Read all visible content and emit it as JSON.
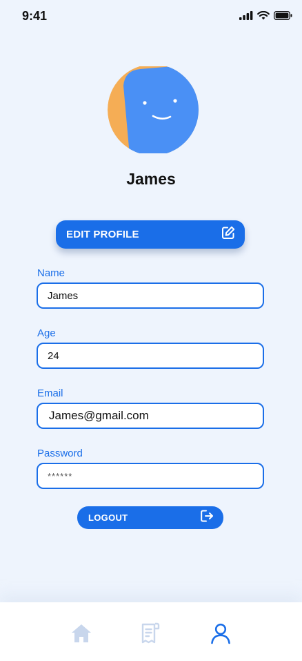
{
  "status_bar": {
    "time": "9:41",
    "icons": [
      "signal-icon",
      "wifi-icon",
      "battery-icon"
    ]
  },
  "profile": {
    "name": "James",
    "avatar_icon": "smiley-avatar-icon"
  },
  "edit_button": {
    "label": "EDIT PROFILE",
    "icon": "edit-icon"
  },
  "form": {
    "name_label": "Name",
    "name_value": "James",
    "age_label": "Age",
    "age_value": "24",
    "email_label": "Email",
    "email_value": "James@gmail.com",
    "password_label": "Password",
    "password_value": "******"
  },
  "logout_button": {
    "label": "LOGOUT",
    "icon": "logout-icon"
  },
  "tabbar": {
    "tabs": [
      {
        "name": "home",
        "icon": "home-icon",
        "active": false
      },
      {
        "name": "receipts",
        "icon": "receipt-icon",
        "active": false
      },
      {
        "name": "profile",
        "icon": "user-icon",
        "active": true
      }
    ]
  },
  "colors": {
    "accent": "#1a6ee8",
    "background": "#eef4fd",
    "avatar_blue": "#4a90f5",
    "avatar_orange": "#f5ad55",
    "inactive_tab": "#c8d6ec"
  }
}
